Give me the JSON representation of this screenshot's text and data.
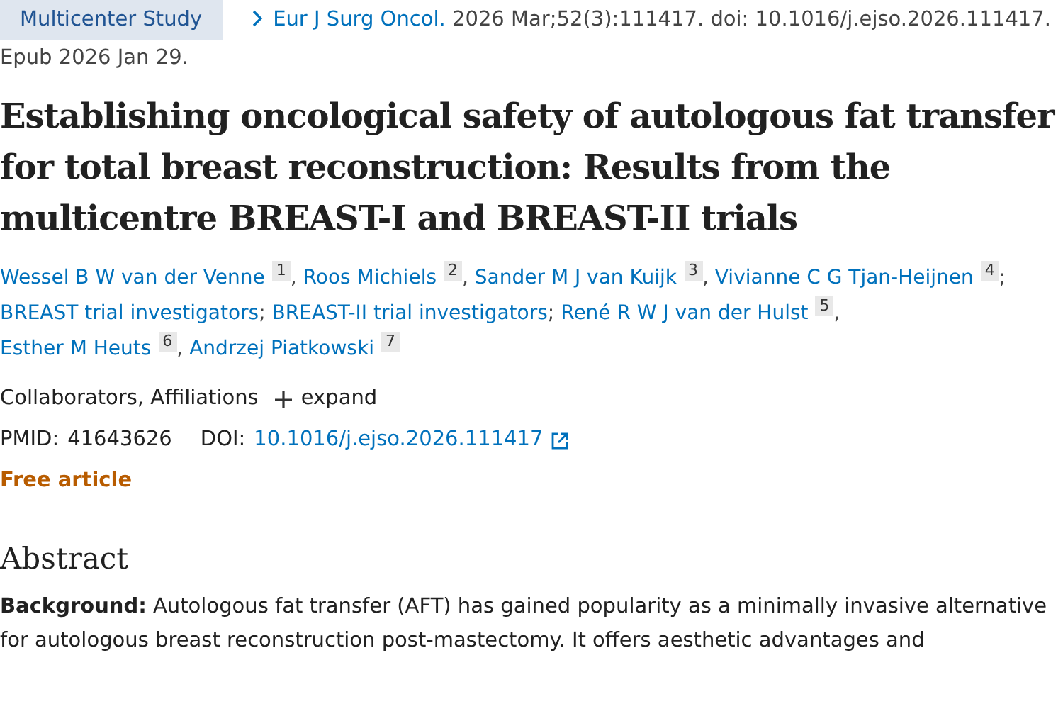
{
  "publication_type": "Multicenter Study",
  "citation": {
    "journal": "Eur J Surg Oncol.",
    "details": "2026 Mar;52(3):111417. doi: 10.1016/j.ejso.2026.111417.",
    "epub": "Epub 2026 Jan 29."
  },
  "title": "Establishing oncological safety of autologous fat transfer for total breast reconstruction: Results from the multicentre BREAST-I and BREAST-II trials",
  "author_lines": [
    [
      {
        "name": "Wessel B W van der Venne",
        "ref": "1",
        "separator": ","
      },
      {
        "name": "Roos Michiels",
        "ref": "2",
        "separator": ","
      },
      {
        "name": "Sander M J van Kuijk",
        "ref": "3",
        "separator": ","
      },
      {
        "name": "Vivianne C G Tjan-Heijnen",
        "ref": "4",
        "separator": ";"
      }
    ],
    [
      {
        "name": "BREAST trial investigators",
        "separator": ";"
      },
      {
        "name": "BREAST-II trial investigators",
        "separator": ";"
      },
      {
        "name": "René R W J van der Hulst",
        "ref": "5",
        "separator": ","
      }
    ],
    [
      {
        "name": "Esther M Heuts",
        "ref": "6",
        "separator": ","
      },
      {
        "name": "Andrzej Piatkowski",
        "ref": "7"
      }
    ]
  ],
  "affiliations": {
    "label": "Collaborators, Affiliations",
    "toggle": "expand"
  },
  "identifiers": {
    "pmid_label": "PMID:",
    "pmid": "41643626",
    "doi_label": "DOI:",
    "doi": "10.1016/j.ejso.2026.111417"
  },
  "access": "Free article",
  "abstract": {
    "heading": "Abstract",
    "paragraph": "**Background:** Autologous fat transfer (AFT) has gained popularity as a minimally invasive alternative for autologous breast reconstruction post-mastectomy. It offers aesthetic advantages and"
  }
}
